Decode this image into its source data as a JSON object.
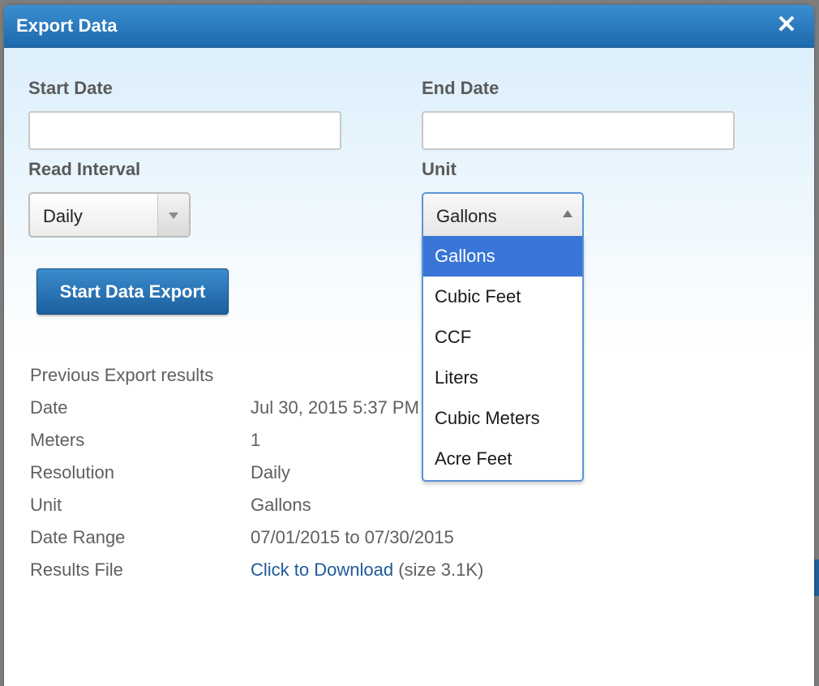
{
  "dialog": {
    "title": "Export Data",
    "close_symbol": "✕"
  },
  "form": {
    "start_date": {
      "label": "Start Date",
      "value": ""
    },
    "end_date": {
      "label": "End Date",
      "value": ""
    },
    "read_interval": {
      "label": "Read Interval",
      "selected": "Daily"
    },
    "unit": {
      "label": "Unit",
      "selected": "Gallons",
      "options": [
        "Gallons",
        "Cubic Feet",
        "CCF",
        "Liters",
        "Cubic Meters",
        "Acre Feet"
      ],
      "highlighted_option": "Gallons"
    },
    "export_button_label": "Start Data Export"
  },
  "results": {
    "title": "Previous Export results",
    "rows": [
      {
        "key": "Date",
        "value": "Jul 30, 2015 5:37 PM"
      },
      {
        "key": "Meters",
        "value": "1"
      },
      {
        "key": "Resolution",
        "value": "Daily"
      },
      {
        "key": "Unit",
        "value": "Gallons"
      },
      {
        "key": "Date Range",
        "value": "07/01/2015 to 07/30/2015"
      }
    ],
    "file": {
      "key": "Results File",
      "link_text": "Click to Download",
      "size_text": "(size 3.1K)"
    }
  },
  "colors": {
    "titlebar": "#2a7bc0",
    "accent": "#3875d7",
    "link": "#1f5a9a"
  },
  "icons": {
    "close": "close-icon",
    "select_arrow_down": "chevron-down-icon",
    "select_arrow_up": "chevron-up-icon"
  }
}
